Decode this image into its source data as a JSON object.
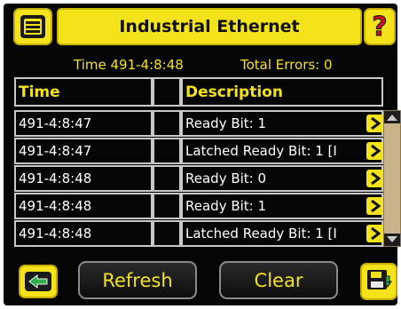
{
  "header": {
    "title": "Industrial Ethernet"
  },
  "status": {
    "time": "Time 491-4:8:48",
    "errors": "Total Errors: 0"
  },
  "table": {
    "columns": [
      "Time",
      "",
      "Description"
    ],
    "rows": [
      {
        "time": "491-4:8:47",
        "flag": "",
        "description": "Ready Bit: 1"
      },
      {
        "time": "491-4:8:47",
        "flag": "",
        "description": "Latched Ready Bit: 1 [I"
      },
      {
        "time": "491-4:8:48",
        "flag": "",
        "description": "Ready Bit: 0"
      },
      {
        "time": "491-4:8:48",
        "flag": "",
        "description": "Ready Bit: 1"
      },
      {
        "time": "491-4:8:48",
        "flag": "",
        "description": "Latched Ready Bit: 1 [I"
      }
    ]
  },
  "buttons": {
    "refresh": "Refresh",
    "clear": "Clear"
  },
  "icons": {
    "menu": "list-menu-icon",
    "help": "question-mark-icon",
    "back": "back-arrow-icon",
    "save": "save-download-icon",
    "row_detail": "chevron-right-icon"
  },
  "colors": {
    "accent": "#f4e21a",
    "background": "#050505",
    "grid": "#c8c8c8"
  }
}
